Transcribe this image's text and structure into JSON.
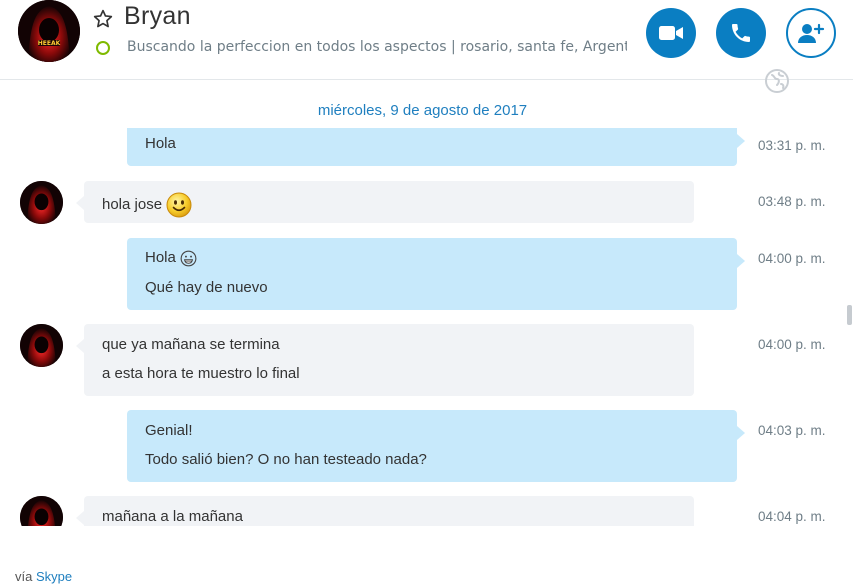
{
  "contact": {
    "name": "Bryan",
    "mood": "Buscando la perfeccion en todos los aspectos  |  rosario, santa fe, Argent...",
    "avatar_text": "HEEAK"
  },
  "header_actions": {
    "video_icon": "video-camera-icon",
    "call_icon": "phone-icon",
    "add_icon": "add-person-icon"
  },
  "conversation": {
    "date": "miércoles, 9 de agosto de 2017",
    "messages": [
      {
        "dir": "out",
        "lines": [
          "Hola"
        ],
        "time": "03:31 p. m."
      },
      {
        "dir": "in",
        "lines": [
          "hola jose"
        ],
        "time": "03:48 p. m."
      },
      {
        "dir": "out",
        "lines": [
          "Hola",
          "Qué hay de nuevo"
        ],
        "time": "04:00 p. m."
      },
      {
        "dir": "in",
        "lines": [
          "que ya mañana se termina",
          "a esta hora te muestro lo final"
        ],
        "time": "04:00 p. m."
      },
      {
        "dir": "out",
        "lines": [
          "Genial!",
          "Todo salió bien? O no han testeado nada?"
        ],
        "time": "04:03 p. m."
      },
      {
        "dir": "in",
        "lines": [
          "mañana  a la mañana"
        ],
        "time": "04:04 p. m."
      }
    ]
  },
  "footer": {
    "prefix": "vía",
    "link": "Skype"
  },
  "colors": {
    "accent": "#0a7ec2",
    "bubble_out": "#c7e9fb",
    "bubble_in": "#f1f3f6",
    "presence": "#7fba00"
  }
}
